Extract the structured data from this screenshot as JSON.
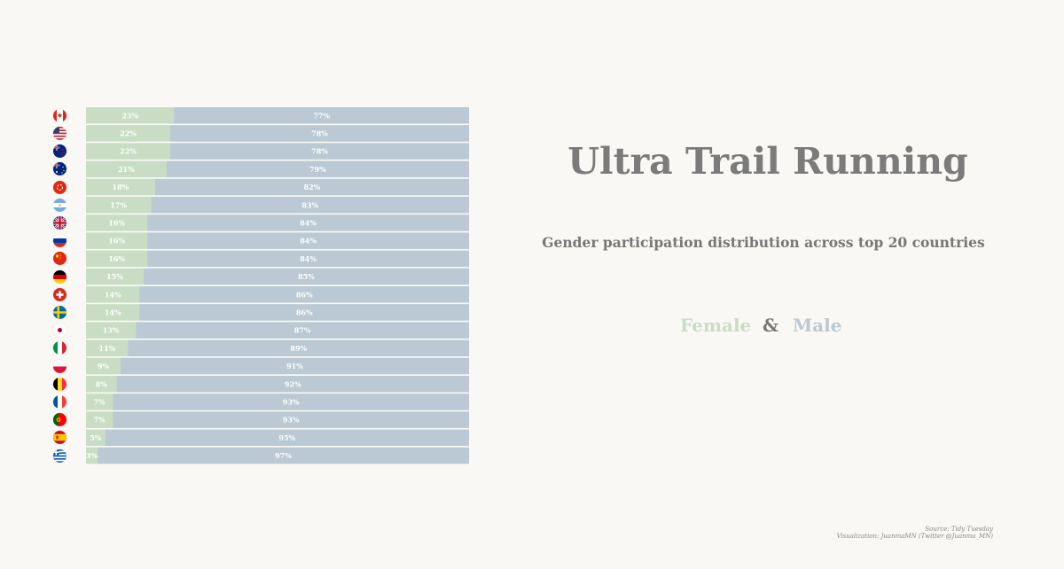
{
  "title": "Ultra Trail Running",
  "subtitle": "Gender participation distribution across top 20 countries",
  "legend": {
    "female": "Female",
    "amp": "&",
    "male": "Male"
  },
  "source": "Source: Tidy Tuesday",
  "credit": "Visualization: JuanmaMN (Twitter @Juanma_MN)",
  "colors": {
    "female": "#c9ddc4",
    "male": "#bac9d3",
    "background": "#faf8f5",
    "label": "#ffffff"
  },
  "chart_data": {
    "type": "bar",
    "stacked": true,
    "orientation": "horizontal",
    "xlim": [
      0,
      100
    ],
    "categories": [
      "Canada",
      "United States",
      "New Zealand",
      "Australia",
      "Hong Kong",
      "Argentina",
      "United Kingdom",
      "Russia",
      "China",
      "Germany",
      "Switzerland",
      "Sweden",
      "Japan",
      "Italy",
      "Poland",
      "Belgium",
      "France",
      "Portugal",
      "Spain",
      "Greece"
    ],
    "flags": [
      "flag-ca-icon",
      "flag-us-icon",
      "flag-nz-icon",
      "flag-au-icon",
      "flag-hk-icon",
      "flag-ar-icon",
      "flag-gb-icon",
      "flag-ru-icon",
      "flag-cn-icon",
      "flag-de-icon",
      "flag-ch-icon",
      "flag-se-icon",
      "flag-jp-icon",
      "flag-it-icon",
      "flag-pl-icon",
      "flag-be-icon",
      "flag-fr-icon",
      "flag-pt-icon",
      "flag-es-icon",
      "flag-gr-icon"
    ],
    "series": [
      {
        "name": "Female",
        "values": [
          23,
          22,
          22,
          21,
          18,
          17,
          16,
          16,
          16,
          15,
          14,
          14,
          13,
          11,
          9,
          8,
          7,
          7,
          5,
          3
        ]
      },
      {
        "name": "Male",
        "values": [
          77,
          78,
          78,
          79,
          82,
          83,
          84,
          84,
          84,
          85,
          86,
          86,
          87,
          89,
          91,
          92,
          93,
          93,
          95,
          97
        ]
      }
    ]
  }
}
